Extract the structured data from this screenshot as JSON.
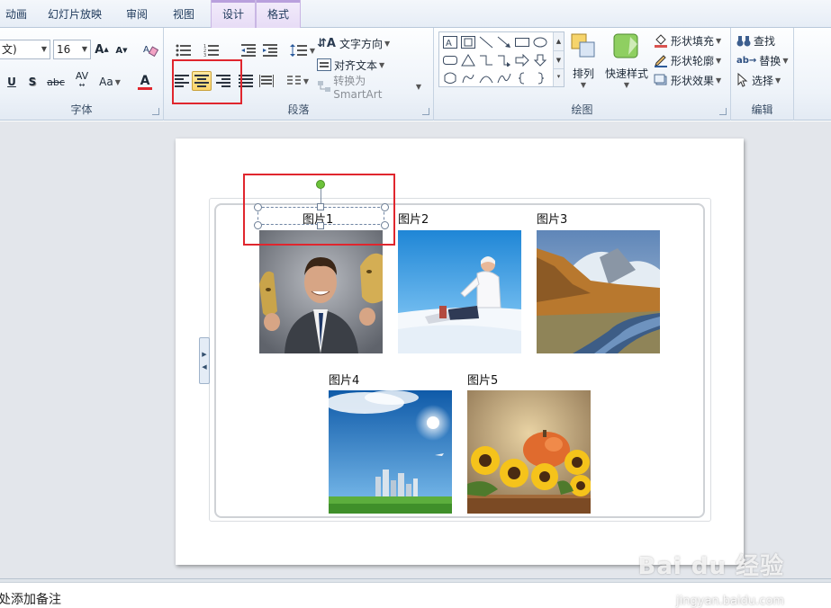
{
  "tabs": [
    {
      "label": "动画"
    },
    {
      "label": "幻灯片放映"
    },
    {
      "label": "审阅"
    },
    {
      "label": "视图"
    },
    {
      "label": "设计"
    },
    {
      "label": "格式"
    }
  ],
  "font_group": {
    "font_name": "文)",
    "font_size": "16",
    "grow_label": "A",
    "shrink_label": "A",
    "underline_label": "U",
    "shadow_label": "S",
    "strike_label": "abc",
    "spacing_label": "AV",
    "case_label": "Aa",
    "color_label": "A",
    "label": "字体"
  },
  "paragraph_group": {
    "text_direction": "文字方向",
    "align_text": "对齐文本",
    "convert_smartart": "转换为 SmartArt",
    "label": "段落"
  },
  "drawing_group": {
    "arrange": "排列",
    "quick_styles": "快速样式",
    "shape_fill": "形状填充",
    "shape_outline": "形状轮廓",
    "shape_effects": "形状效果",
    "label": "绘图"
  },
  "editing_group": {
    "find": "查找",
    "replace": "替换",
    "select": "选择",
    "label": "编辑"
  },
  "slide": {
    "pictures": [
      {
        "caption": "图片1"
      },
      {
        "caption": "图片2"
      },
      {
        "caption": "图片3"
      },
      {
        "caption": "图片4"
      },
      {
        "caption": "图片5"
      }
    ]
  },
  "notes": {
    "placeholder": "处添加备注"
  },
  "watermark": {
    "main": "Bai du 经验",
    "sub": "jingyan.baidu.com"
  },
  "colors": {
    "highlight": "#e0262e",
    "active_button": "#fbd56a",
    "rotation_handle": "#6cc23a"
  }
}
